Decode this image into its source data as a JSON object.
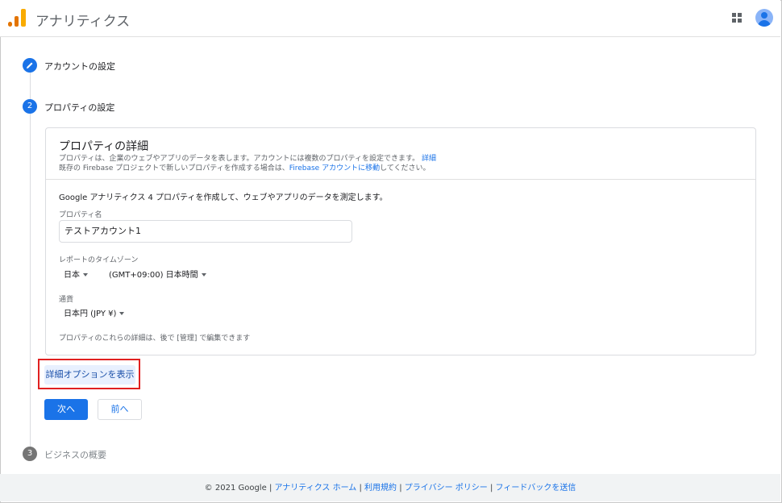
{
  "header": {
    "app_title": "アナリティクス"
  },
  "steps": [
    {
      "number": "",
      "label": "アカウントの設定",
      "state": "completed",
      "icon": "pencil-icon"
    },
    {
      "number": "2",
      "label": "プロパティの設定",
      "state": "active"
    },
    {
      "number": "3",
      "label": "ビジネスの概要",
      "state": "pending"
    }
  ],
  "card": {
    "title": "プロパティの詳細",
    "desc_line1": "プロパティは、企業のウェブやアプリのデータを表します。アカウントには複数のプロパティを設定できます。",
    "desc_line1_link": "詳細",
    "desc_line2_a": "既存の Firebase プロジェクトで新しいプロパティを作成する場合は、",
    "desc_line2_link": "Firebase アカウントに移動",
    "desc_line2_b": "してください。",
    "intro": "Google アナリティクス 4 プロパティを作成して、ウェブやアプリのデータを測定します。",
    "property_name_label": "プロパティ名",
    "property_name_value": "テストアカウント1",
    "timezone_label": "レポートのタイムゾーン",
    "timezone_country": "日本",
    "timezone_value": "(GMT+09:00) 日本時間",
    "currency_label": "通貨",
    "currency_value": "日本円 (JPY ¥)",
    "note": "プロパティのこれらの詳細は、後で [管理] で編集できます"
  },
  "buttons": {
    "advanced": "詳細オプションを表示",
    "next": "次へ",
    "prev": "前へ"
  },
  "footer": {
    "copyright": "© 2021 Google",
    "separator": "|",
    "links": [
      "アナリティクス ホーム",
      "利用規約",
      "プライバシー ポリシー",
      "フィードバックを送信"
    ]
  },
  "colors": {
    "accent": "#1a73e8",
    "highlight_border": "#e02020"
  }
}
